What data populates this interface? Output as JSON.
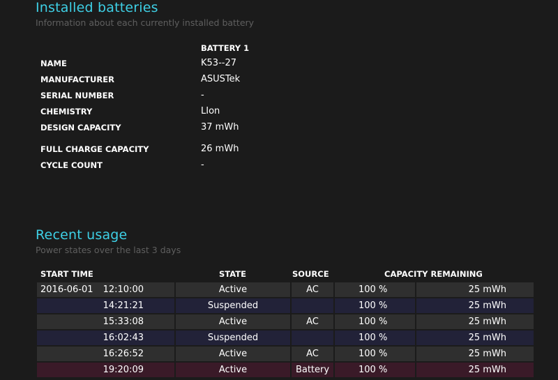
{
  "installed": {
    "title": "Installed batteries",
    "subtitle": "Information about each currently installed battery",
    "battery_header": "BATTERY 1",
    "rows": [
      {
        "label": "NAME",
        "value": "K53--27"
      },
      {
        "label": "MANUFACTURER",
        "value": "ASUSTek"
      },
      {
        "label": "SERIAL NUMBER",
        "value": "-"
      },
      {
        "label": "CHEMISTRY",
        "value": "LIon"
      },
      {
        "label": "DESIGN CAPACITY",
        "value": "37 mWh"
      },
      {
        "label": "FULL CHARGE CAPACITY",
        "value": "26 mWh"
      },
      {
        "label": "CYCLE COUNT",
        "value": "-"
      }
    ]
  },
  "recent": {
    "title": "Recent usage",
    "subtitle": "Power states over the last 3 days",
    "columns": {
      "start_time": "START TIME",
      "state": "STATE",
      "source": "SOURCE",
      "capacity": "CAPACITY REMAINING"
    },
    "rows": [
      {
        "date": "2016-06-01",
        "time": "12:10:00",
        "state": "Active",
        "source": "AC",
        "percent": "100 %",
        "mwh": "25 mWh"
      },
      {
        "date": "",
        "time": "14:21:21",
        "state": "Suspended",
        "source": "",
        "percent": "100 %",
        "mwh": "25 mWh"
      },
      {
        "date": "",
        "time": "15:33:08",
        "state": "Active",
        "source": "AC",
        "percent": "100 %",
        "mwh": "25 mWh"
      },
      {
        "date": "",
        "time": "16:02:43",
        "state": "Suspended",
        "source": "",
        "percent": "100 %",
        "mwh": "25 mWh"
      },
      {
        "date": "",
        "time": "16:26:52",
        "state": "Active",
        "source": "AC",
        "percent": "100 %",
        "mwh": "25 mWh"
      },
      {
        "date": "",
        "time": "19:20:09",
        "state": "Active",
        "source": "Battery",
        "percent": "100 %",
        "mwh": "25 mWh"
      }
    ]
  },
  "colors": {
    "title_accent": "#3ed0e6",
    "active_row": "#2f2f2f",
    "suspended_row": "#222238",
    "battery_row": "#3a1a28"
  }
}
